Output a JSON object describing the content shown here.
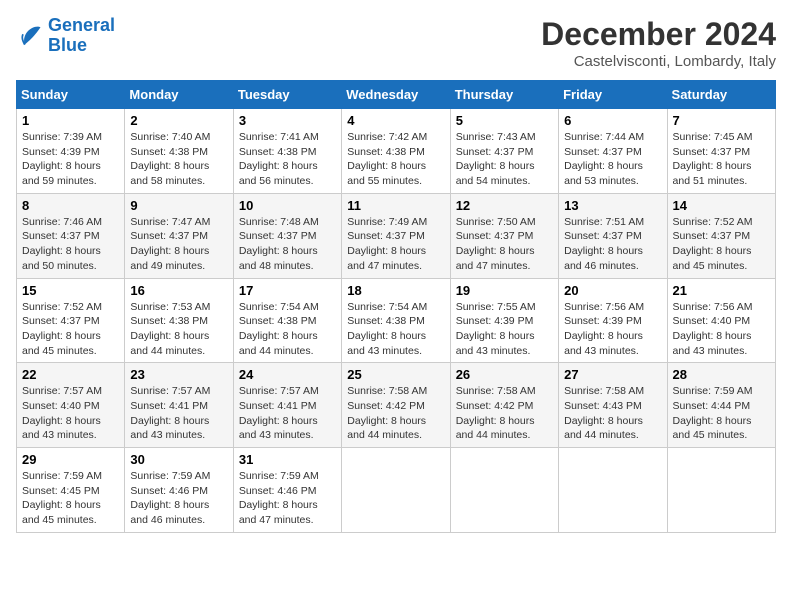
{
  "header": {
    "logo_line1": "General",
    "logo_line2": "Blue",
    "month": "December 2024",
    "location": "Castelvisconti, Lombardy, Italy"
  },
  "weekdays": [
    "Sunday",
    "Monday",
    "Tuesday",
    "Wednesday",
    "Thursday",
    "Friday",
    "Saturday"
  ],
  "weeks": [
    [
      {
        "day": "1",
        "sunrise": "Sunrise: 7:39 AM",
        "sunset": "Sunset: 4:39 PM",
        "daylight": "Daylight: 8 hours and 59 minutes."
      },
      {
        "day": "2",
        "sunrise": "Sunrise: 7:40 AM",
        "sunset": "Sunset: 4:38 PM",
        "daylight": "Daylight: 8 hours and 58 minutes."
      },
      {
        "day": "3",
        "sunrise": "Sunrise: 7:41 AM",
        "sunset": "Sunset: 4:38 PM",
        "daylight": "Daylight: 8 hours and 56 minutes."
      },
      {
        "day": "4",
        "sunrise": "Sunrise: 7:42 AM",
        "sunset": "Sunset: 4:38 PM",
        "daylight": "Daylight: 8 hours and 55 minutes."
      },
      {
        "day": "5",
        "sunrise": "Sunrise: 7:43 AM",
        "sunset": "Sunset: 4:37 PM",
        "daylight": "Daylight: 8 hours and 54 minutes."
      },
      {
        "day": "6",
        "sunrise": "Sunrise: 7:44 AM",
        "sunset": "Sunset: 4:37 PM",
        "daylight": "Daylight: 8 hours and 53 minutes."
      },
      {
        "day": "7",
        "sunrise": "Sunrise: 7:45 AM",
        "sunset": "Sunset: 4:37 PM",
        "daylight": "Daylight: 8 hours and 51 minutes."
      }
    ],
    [
      {
        "day": "8",
        "sunrise": "Sunrise: 7:46 AM",
        "sunset": "Sunset: 4:37 PM",
        "daylight": "Daylight: 8 hours and 50 minutes."
      },
      {
        "day": "9",
        "sunrise": "Sunrise: 7:47 AM",
        "sunset": "Sunset: 4:37 PM",
        "daylight": "Daylight: 8 hours and 49 minutes."
      },
      {
        "day": "10",
        "sunrise": "Sunrise: 7:48 AM",
        "sunset": "Sunset: 4:37 PM",
        "daylight": "Daylight: 8 hours and 48 minutes."
      },
      {
        "day": "11",
        "sunrise": "Sunrise: 7:49 AM",
        "sunset": "Sunset: 4:37 PM",
        "daylight": "Daylight: 8 hours and 47 minutes."
      },
      {
        "day": "12",
        "sunrise": "Sunrise: 7:50 AM",
        "sunset": "Sunset: 4:37 PM",
        "daylight": "Daylight: 8 hours and 47 minutes."
      },
      {
        "day": "13",
        "sunrise": "Sunrise: 7:51 AM",
        "sunset": "Sunset: 4:37 PM",
        "daylight": "Daylight: 8 hours and 46 minutes."
      },
      {
        "day": "14",
        "sunrise": "Sunrise: 7:52 AM",
        "sunset": "Sunset: 4:37 PM",
        "daylight": "Daylight: 8 hours and 45 minutes."
      }
    ],
    [
      {
        "day": "15",
        "sunrise": "Sunrise: 7:52 AM",
        "sunset": "Sunset: 4:37 PM",
        "daylight": "Daylight: 8 hours and 45 minutes."
      },
      {
        "day": "16",
        "sunrise": "Sunrise: 7:53 AM",
        "sunset": "Sunset: 4:38 PM",
        "daylight": "Daylight: 8 hours and 44 minutes."
      },
      {
        "day": "17",
        "sunrise": "Sunrise: 7:54 AM",
        "sunset": "Sunset: 4:38 PM",
        "daylight": "Daylight: 8 hours and 44 minutes."
      },
      {
        "day": "18",
        "sunrise": "Sunrise: 7:54 AM",
        "sunset": "Sunset: 4:38 PM",
        "daylight": "Daylight: 8 hours and 43 minutes."
      },
      {
        "day": "19",
        "sunrise": "Sunrise: 7:55 AM",
        "sunset": "Sunset: 4:39 PM",
        "daylight": "Daylight: 8 hours and 43 minutes."
      },
      {
        "day": "20",
        "sunrise": "Sunrise: 7:56 AM",
        "sunset": "Sunset: 4:39 PM",
        "daylight": "Daylight: 8 hours and 43 minutes."
      },
      {
        "day": "21",
        "sunrise": "Sunrise: 7:56 AM",
        "sunset": "Sunset: 4:40 PM",
        "daylight": "Daylight: 8 hours and 43 minutes."
      }
    ],
    [
      {
        "day": "22",
        "sunrise": "Sunrise: 7:57 AM",
        "sunset": "Sunset: 4:40 PM",
        "daylight": "Daylight: 8 hours and 43 minutes."
      },
      {
        "day": "23",
        "sunrise": "Sunrise: 7:57 AM",
        "sunset": "Sunset: 4:41 PM",
        "daylight": "Daylight: 8 hours and 43 minutes."
      },
      {
        "day": "24",
        "sunrise": "Sunrise: 7:57 AM",
        "sunset": "Sunset: 4:41 PM",
        "daylight": "Daylight: 8 hours and 43 minutes."
      },
      {
        "day": "25",
        "sunrise": "Sunrise: 7:58 AM",
        "sunset": "Sunset: 4:42 PM",
        "daylight": "Daylight: 8 hours and 44 minutes."
      },
      {
        "day": "26",
        "sunrise": "Sunrise: 7:58 AM",
        "sunset": "Sunset: 4:42 PM",
        "daylight": "Daylight: 8 hours and 44 minutes."
      },
      {
        "day": "27",
        "sunrise": "Sunrise: 7:58 AM",
        "sunset": "Sunset: 4:43 PM",
        "daylight": "Daylight: 8 hours and 44 minutes."
      },
      {
        "day": "28",
        "sunrise": "Sunrise: 7:59 AM",
        "sunset": "Sunset: 4:44 PM",
        "daylight": "Daylight: 8 hours and 45 minutes."
      }
    ],
    [
      {
        "day": "29",
        "sunrise": "Sunrise: 7:59 AM",
        "sunset": "Sunset: 4:45 PM",
        "daylight": "Daylight: 8 hours and 45 minutes."
      },
      {
        "day": "30",
        "sunrise": "Sunrise: 7:59 AM",
        "sunset": "Sunset: 4:46 PM",
        "daylight": "Daylight: 8 hours and 46 minutes."
      },
      {
        "day": "31",
        "sunrise": "Sunrise: 7:59 AM",
        "sunset": "Sunset: 4:46 PM",
        "daylight": "Daylight: 8 hours and 47 minutes."
      },
      null,
      null,
      null,
      null
    ]
  ]
}
